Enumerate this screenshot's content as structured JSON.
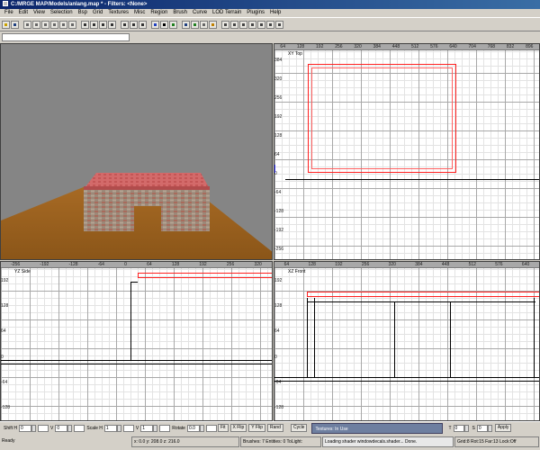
{
  "window": {
    "title": "C:/MRGE MAP/Models/anlang.map * - Filters: <None>"
  },
  "menu": [
    "File",
    "Edit",
    "View",
    "Selection",
    "Bsp",
    "Grid",
    "Textures",
    "Misc",
    "Region",
    "Brush",
    "Curve",
    "LOD Terrain",
    "Plugins",
    "Help"
  ],
  "filter_input": {
    "value": ""
  },
  "xy_view": {
    "label": "XY Top",
    "x_ticks": [
      "64",
      "128",
      "192",
      "256",
      "320",
      "384",
      "448",
      "512",
      "576",
      "640",
      "704",
      "768",
      "832",
      "896"
    ],
    "y_ticks": [
      "384",
      "320",
      "256",
      "192",
      "128",
      "64",
      "0",
      "-64",
      "-128",
      "-192",
      "-256"
    ]
  },
  "yz_view": {
    "label": "YZ Side",
    "x_ticks": [
      "-256",
      "-192",
      "-128",
      "-64",
      "0",
      "64",
      "128",
      "192",
      "256",
      "320"
    ],
    "y_ticks": [
      "192",
      "128",
      "64",
      "0",
      "-64",
      "-128"
    ]
  },
  "xz_view": {
    "label": "XZ Front",
    "x_ticks": [
      "64",
      "128",
      "192",
      "256",
      "320",
      "384",
      "448",
      "512",
      "576",
      "640"
    ],
    "y_ticks": [
      "192",
      "128",
      "64",
      "0",
      "-64",
      "-128"
    ]
  },
  "controls": {
    "shift_label": "Shift H",
    "shift_h": "0",
    "v_label": "V",
    "shift_v": "0",
    "scale_label": "Scale H",
    "scale_h": "1",
    "scale_v_label": "V",
    "scale_v": "1",
    "rotate_label": "Rotate",
    "rotate": "0.0",
    "fit_label": "Fit",
    "xflip_label": "X Flip",
    "yflip_label": "Y Flip",
    "rand_label": "Rand",
    "cycle_label": "Cycle",
    "textures_panel": "Textures: In Use",
    "t_label": "T",
    "t_value": "0",
    "s_label": "S",
    "s_value": "0",
    "apply_label": "Apply"
  },
  "status": {
    "ready": "Ready",
    "coords": "x: 0.0  y: 208.0  z: 216.0",
    "brushes": "Brushes: 7  Entities: 0  ToLight:",
    "log": "Loading shader windowdecals.shader... Done.",
    "grid": "Grid:8  Rot:15  Far:13  Lock:Off"
  },
  "colors": {
    "selection": "#ff2020",
    "title_bar": "#0a246a",
    "textures_panel": "#6e7fa0"
  }
}
